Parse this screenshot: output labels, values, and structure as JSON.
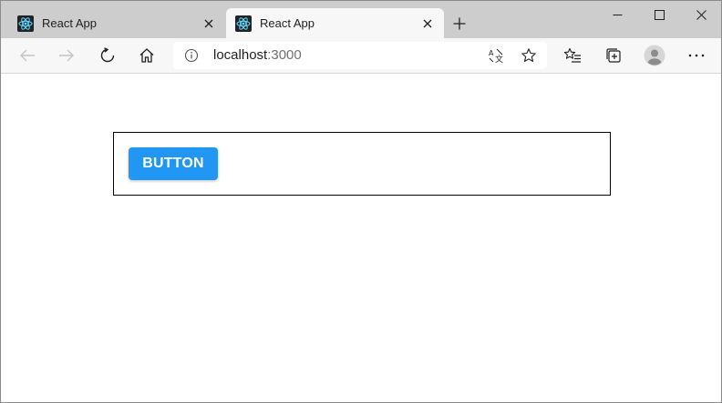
{
  "browser": {
    "tabs": [
      {
        "title": "React App",
        "active": false
      },
      {
        "title": "React App",
        "active": true
      }
    ],
    "new_tab_icon": "plus-icon",
    "window_controls": [
      "minimize-icon",
      "maximize-icon",
      "close-icon"
    ],
    "address_bar": {
      "host": "localhost",
      "port": ":3000"
    },
    "toolbar_icons": [
      "back-icon",
      "forward-icon",
      "refresh-icon",
      "home-icon",
      "info-icon",
      "read-aloud-icon",
      "favorite-star-icon",
      "favorites-icon",
      "collections-icon",
      "profile-icon",
      "more-icon"
    ]
  },
  "page": {
    "button_label": "Button",
    "button_color": "#2196f3"
  },
  "colors": {
    "tabstrip": "#cdcdcd",
    "toolbar": "#f7f7f7",
    "react_logo": "#61dafb"
  }
}
